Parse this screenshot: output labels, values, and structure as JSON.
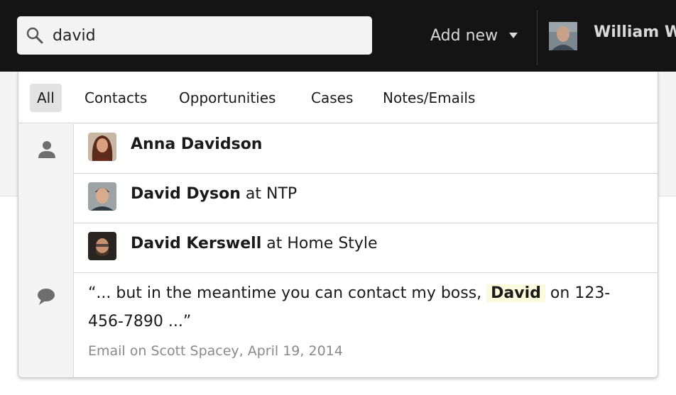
{
  "search": {
    "value": "david"
  },
  "header": {
    "add_new_label": "Add new",
    "user_name": "William Wo"
  },
  "tabs": [
    {
      "label": "All"
    },
    {
      "label": "Contacts"
    },
    {
      "label": "Opportunities"
    },
    {
      "label": "Cases"
    },
    {
      "label": "Notes/Emails"
    }
  ],
  "contacts": [
    {
      "name": "Anna Davidson",
      "at": "",
      "company": ""
    },
    {
      "name": "David Dyson",
      "at": "at",
      "company": "NTP"
    },
    {
      "name": "David Kerswell",
      "at": "at",
      "company": "Home Style"
    }
  ],
  "note": {
    "quote_before": "“... but in the meantime you can contact my boss,",
    "highlight": "David",
    "quote_after": "on 123-456-7890 ...”",
    "meta": "Email on Scott Spacey, April 19, 2014"
  },
  "icons": {
    "search": "search-icon",
    "caret": "chevron-down-icon",
    "contacts_section": "person-icon",
    "notes_section": "speech-bubble-icon"
  },
  "colors": {
    "topbar": "#141414",
    "highlight": "#fbfadc",
    "active_tab": "#e2e2e2"
  }
}
